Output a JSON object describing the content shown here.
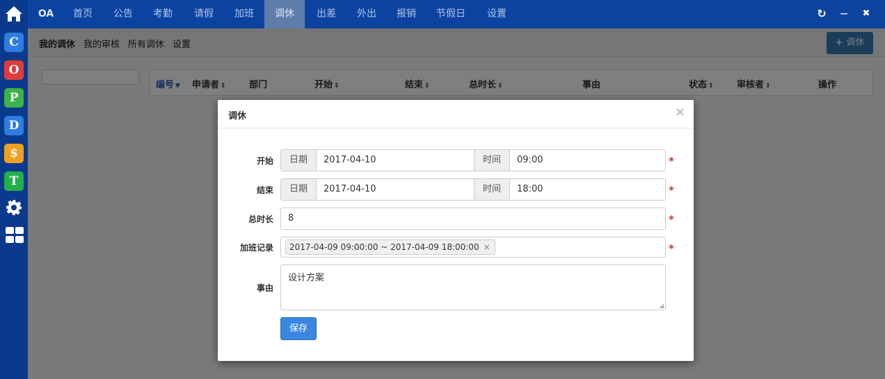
{
  "app": {
    "brand": "OA"
  },
  "topnav": {
    "items": [
      {
        "label": "首页"
      },
      {
        "label": "公告"
      },
      {
        "label": "考勤"
      },
      {
        "label": "请假"
      },
      {
        "label": "加班"
      },
      {
        "label": "调休",
        "active": true
      },
      {
        "label": "出差"
      },
      {
        "label": "外出"
      },
      {
        "label": "报销"
      },
      {
        "label": "节假日"
      },
      {
        "label": "设置"
      }
    ],
    "window_controls": {
      "refresh": "↻",
      "minimize": "—",
      "close": "✖"
    }
  },
  "sidebar": {
    "apps": [
      {
        "letter": "C",
        "color": "#2d7de2",
        "icon": "c-app-icon"
      },
      {
        "letter": "O",
        "color": "#e03b3b",
        "icon": "o-app-icon"
      },
      {
        "letter": "P",
        "color": "#3bb34a",
        "icon": "p-app-icon"
      },
      {
        "letter": "D",
        "color": "#2d7de2",
        "icon": "d-app-icon"
      },
      {
        "letter": "$",
        "color": "#f0a020",
        "icon": "dollar-app-icon"
      },
      {
        "letter": "T",
        "color": "#23b04a",
        "icon": "t-app-icon"
      }
    ],
    "settings_icon": "gear-icon",
    "grid_icon": "grid-icon"
  },
  "subnav": {
    "items": [
      {
        "label": "我的调休",
        "active": true
      },
      {
        "label": "我的审核"
      },
      {
        "label": "所有调休"
      },
      {
        "label": "设置"
      }
    ],
    "add_button": "调休"
  },
  "table": {
    "columns": [
      {
        "label": "编号",
        "sort": "▼",
        "sorted": true
      },
      {
        "label": "申请者",
        "sort": "⇕"
      },
      {
        "label": "部门"
      },
      {
        "label": "开始",
        "sort": "⇕"
      },
      {
        "label": "结束",
        "sort": "⇕"
      },
      {
        "label": "总时长",
        "sort": "⇕"
      },
      {
        "label": "事由"
      },
      {
        "label": "状态",
        "sort": "⇕"
      },
      {
        "label": "审核者",
        "sort": "⇕"
      },
      {
        "label": "操作"
      }
    ]
  },
  "modal": {
    "title": "调休",
    "close": "×",
    "start": {
      "label": "开始",
      "date_addon": "日期",
      "date": "2017-04-10",
      "time_addon": "时间",
      "time": "09:00"
    },
    "end": {
      "label": "结束",
      "date_addon": "日期",
      "date": "2017-04-10",
      "time_addon": "时间",
      "time": "18:00"
    },
    "duration": {
      "label": "总时长",
      "value": "8"
    },
    "overtime": {
      "label": "加班记录",
      "tag": "2017-04-09 09:00:00 ~ 2017-04-09 18:00:00",
      "tag_remove": "×"
    },
    "reason": {
      "label": "事由",
      "value": "设计方案"
    },
    "required_mark": "*",
    "save_button": "保存"
  },
  "colors": {
    "topnav": "#0d43a0",
    "sidebar": "#0b3a8c",
    "primary": "#337ab7",
    "required": "#d9302a"
  }
}
